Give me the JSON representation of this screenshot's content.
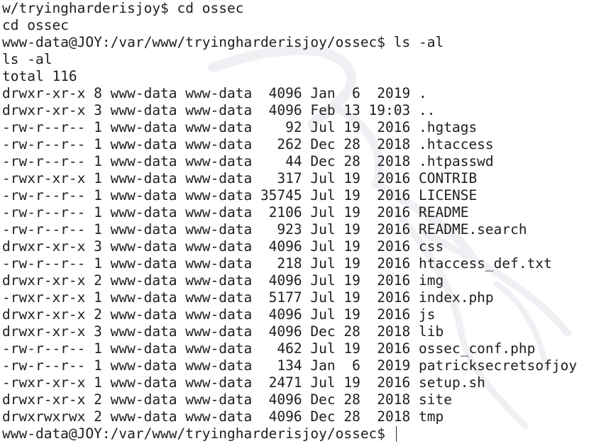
{
  "terminal": {
    "lines": [
      "w/tryingharderisjoy$ cd ossec",
      "cd ossec",
      "www-data@JOY:/var/www/tryingharderisjoy/ossec$ ls -al",
      "ls -al",
      "total 116",
      "drwxr-xr-x 8 www-data www-data  4096 Jan  6  2019 .",
      "drwxr-xr-x 3 www-data www-data  4096 Feb 13 19:03 ..",
      "-rw-r--r-- 1 www-data www-data    92 Jul 19  2016 .hgtags",
      "-rw-r--r-- 1 www-data www-data   262 Dec 28  2018 .htaccess",
      "-rw-r--r-- 1 www-data www-data    44 Dec 28  2018 .htpasswd",
      "-rwxr-xr-x 1 www-data www-data   317 Jul 19  2016 CONTRIB",
      "-rw-r--r-- 1 www-data www-data 35745 Jul 19  2016 LICENSE",
      "-rw-r--r-- 1 www-data www-data  2106 Jul 19  2016 README",
      "-rw-r--r-- 1 www-data www-data   923 Jul 19  2016 README.search",
      "drwxr-xr-x 3 www-data www-data  4096 Jul 19  2016 css",
      "-rw-r--r-- 1 www-data www-data   218 Jul 19  2016 htaccess_def.txt",
      "drwxr-xr-x 2 www-data www-data  4096 Jul 19  2016 img",
      "-rwxr-xr-x 1 www-data www-data  5177 Jul 19  2016 index.php",
      "drwxr-xr-x 2 www-data www-data  4096 Jul 19  2016 js",
      "drwxr-xr-x 3 www-data www-data  4096 Dec 28  2018 lib",
      "-rw-r--r-- 1 www-data www-data   462 Jul 19  2016 ossec_conf.php",
      "-rw-r--r-- 1 www-data www-data   134 Jan  6  2019 patricksecretsofjoy",
      "-rwxr-xr-x 1 www-data www-data  2471 Jul 19  2016 setup.sh",
      "drwxr-xr-x 2 www-data www-data  4096 Dec 28  2018 site",
      "drwxrwxrwx 2 www-data www-data  4096 Dec 28  2018 tmp"
    ],
    "prompt": "www-data@JOY:/var/www/tryingharderisjoy/ossec$ ",
    "colors": {
      "background": "#ffffff",
      "text": "#1e1e1e",
      "watermark": "#eef0f3"
    },
    "watermark_icon": "kali-dragon-logo"
  }
}
